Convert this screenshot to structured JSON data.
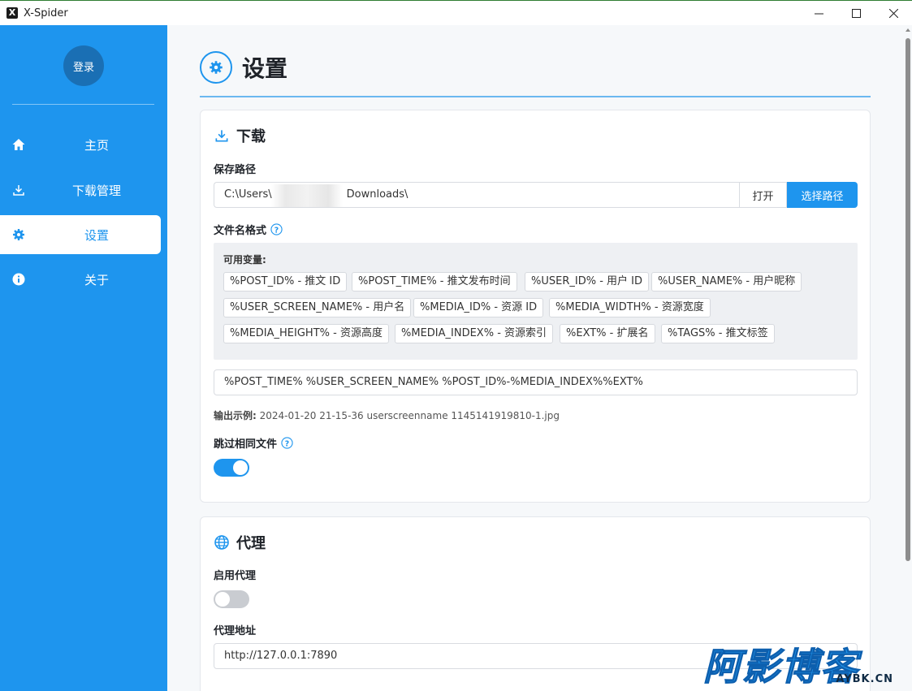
{
  "window": {
    "title": "X-Spider",
    "minimize": "—",
    "maximize": "☐",
    "close": "✕"
  },
  "sidebar": {
    "login_label": "登录",
    "items": [
      {
        "label": "主页",
        "icon": "home-icon"
      },
      {
        "label": "下载管理",
        "icon": "download-icon"
      },
      {
        "label": "设置",
        "icon": "gear-icon",
        "active": true
      },
      {
        "label": "关于",
        "icon": "info-icon"
      }
    ]
  },
  "page": {
    "title": "设置"
  },
  "download": {
    "title": "下载",
    "save_path_label": "保存路径",
    "save_path_prefix": "C:\\Users\\",
    "save_path_suffix": "Downloads\\",
    "open_label": "打开",
    "choose_label": "选择路径",
    "filename_format_label": "文件名格式",
    "vars_title": "可用变量:",
    "variables": [
      "%POST_ID% - 推文 ID",
      "%POST_TIME% - 推文发布时间",
      "%USER_ID% - 用户 ID",
      "%USER_NAME% - 用户昵称",
      "%USER_SCREEN_NAME% - 用户名",
      "%MEDIA_ID% - 资源 ID",
      "%MEDIA_WIDTH% - 资源宽度",
      "%MEDIA_HEIGHT% - 资源高度",
      "%MEDIA_INDEX% - 资源索引",
      "%EXT% - 扩展名",
      "%TAGS% - 推文标签"
    ],
    "format_value": "%POST_TIME% %USER_SCREEN_NAME% %POST_ID%-%MEDIA_INDEX%%EXT%",
    "example_label": "输出示例:",
    "example_value": "2024-01-20 21-15-36 userscreenname 1145141919810-1.jpg",
    "skip_same_label": "跳过相同文件",
    "skip_same_enabled": true
  },
  "proxy": {
    "title": "代理",
    "enable_label": "启用代理",
    "enabled": false,
    "address_label": "代理地址",
    "address_value": "http://127.0.0.1:7890"
  },
  "watermark": {
    "main": "阿影博客",
    "sub": "AYBK.CN"
  },
  "colors": {
    "accent": "#1e95ee",
    "sidebar": "#1e95ee",
    "avatar": "#1a6fb4"
  }
}
